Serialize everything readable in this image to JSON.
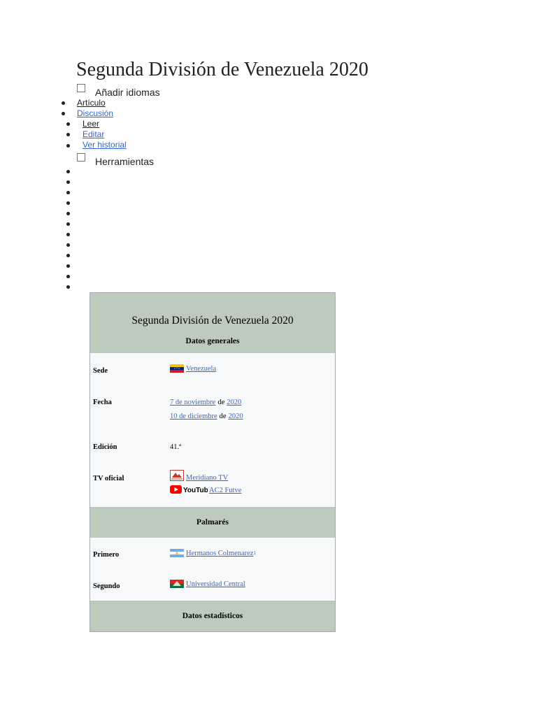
{
  "page": {
    "title": "Segunda División de Venezuela 2020",
    "language_label": "Añadir idiomas",
    "tabs": [
      "Artículo",
      "Discusión"
    ],
    "views": [
      "Leer",
      "Editar",
      "Ver historial"
    ],
    "tools_label": "Herramientas"
  },
  "infobox": {
    "title": "Segunda División de Venezuela 2020",
    "section_general": "Datos generales",
    "sede_label": "Sede",
    "sede_value": "Venezuela",
    "fecha_label": "Fecha",
    "fecha1_date": "7 de noviembre",
    "fecha_de": "de",
    "fecha1_year": "2020",
    "fecha2_date": "10 de diciembre",
    "fecha2_year": "2020",
    "edicion_label": "Edición",
    "edicion_value": "41.ª",
    "tv_label": "TV oficial",
    "tv1": "Meridiano TV",
    "tv2_logo": "YouTube",
    "tv2": "AC2 Futve",
    "section_palmares": "Palmarés",
    "primero_label": "Primero",
    "primero_value": "Hermanos Colmenarez",
    "primero_sup": "1",
    "segundo_label": "Segundo",
    "segundo_value": "Universidad Central",
    "section_stats": "Datos estadísticos"
  }
}
